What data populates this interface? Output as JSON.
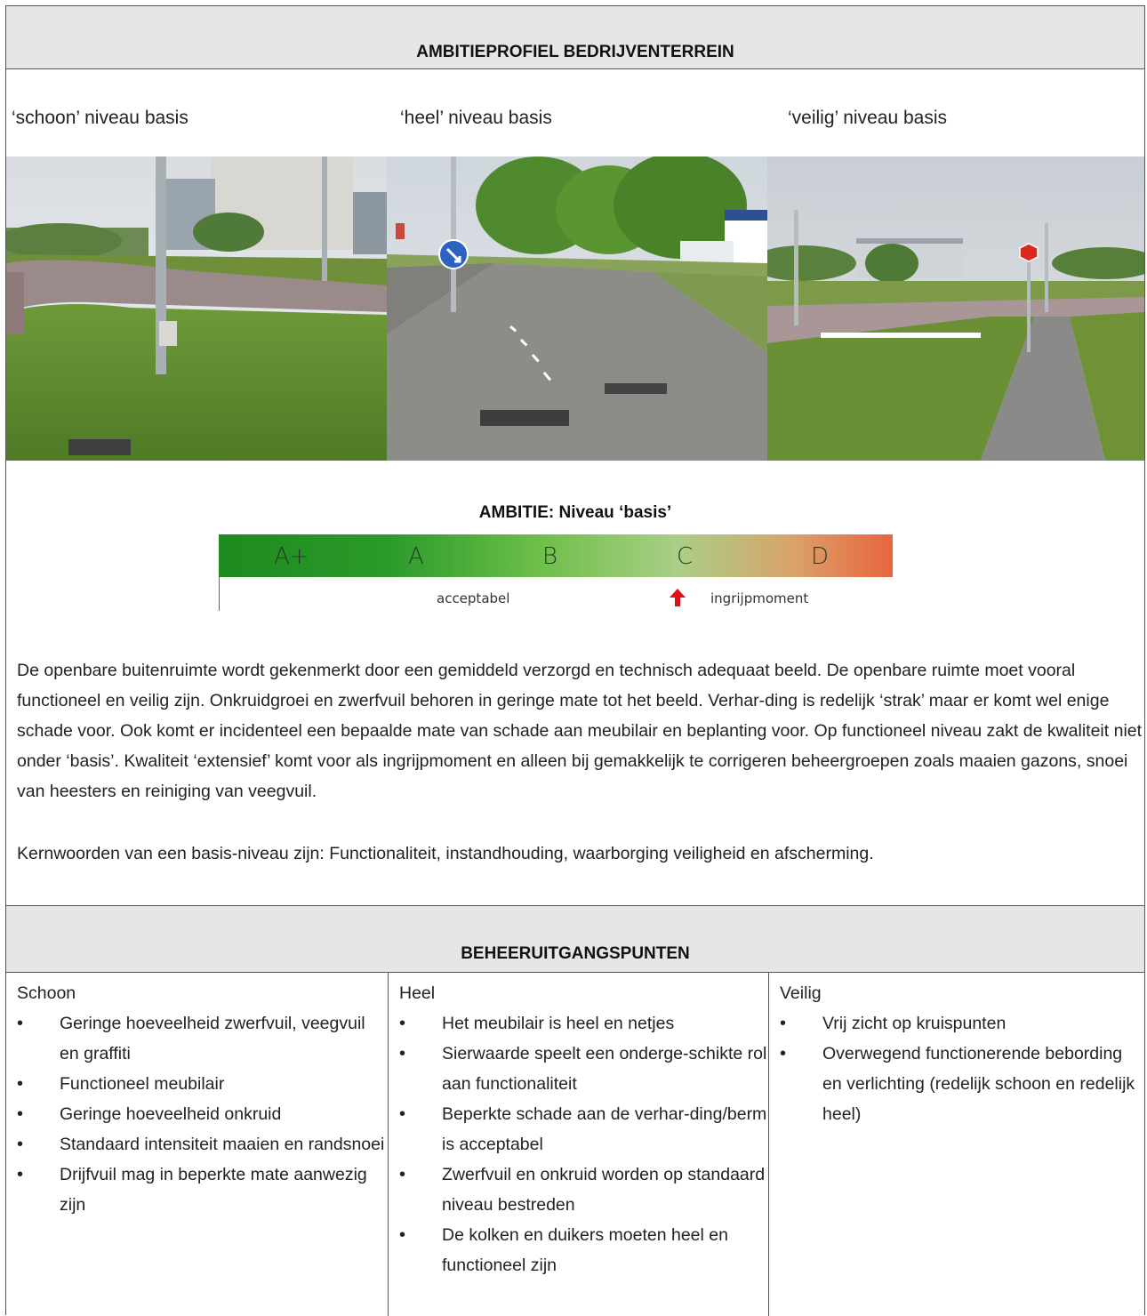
{
  "header": {
    "title": "AMBITIEPROFIEL BEDRIJVENTERREIN"
  },
  "captions": [
    "‘schoon’ niveau basis",
    "‘heel’ niveau basis",
    "‘veilig’ niveau basis"
  ],
  "ambition": {
    "title": "AMBITIE: Niveau ‘basis’",
    "levels": [
      "A+",
      "A",
      "B",
      "C",
      "D"
    ],
    "labels": {
      "acceptable": "acceptabel",
      "intervention": "ingrijpmoment"
    },
    "colors": {
      "start": "#1f8a1f",
      "end": "#e8653f",
      "arrow": "#e01010"
    }
  },
  "description": {
    "p1": "De openbare buitenruimte wordt gekenmerkt door een gemiddeld verzorgd en technisch adequaat beeld. De openbare ruimte moet vooral functioneel en veilig zijn. Onkruidgroei en zwerfvuil behoren in geringe mate tot het beeld. Verhar-ding is redelijk ‘strak’ maar er komt wel enige schade voor. Ook komt er incidenteel een bepaalde mate van schade aan meubilair en beplanting voor. Op functioneel niveau zakt de kwaliteit niet onder ‘basis’. Kwaliteit ‘extensief’ komt voor als ingrijpmoment en alleen bij gemakkelijk te corrigeren beheergroepen zoals maaien gazons, snoei van heesters en reiniging van veegvuil.",
    "p2": "Kernwoorden van een basis-niveau zijn: Functionaliteit, instandhouding, waarborging veiligheid en afscherming."
  },
  "management": {
    "title": "BEHEERUITGANGSPUNTEN",
    "columns": [
      {
        "heading": "Schoon",
        "items": [
          "Geringe hoeveelheid zwerfvuil, veegvuil en graffiti",
          "Functioneel meubilair",
          "Geringe hoeveelheid onkruid",
          "Standaard intensiteit maaien en randsnoei",
          "Drijfvuil mag in beperkte mate aanwezig zijn"
        ]
      },
      {
        "heading": "Heel",
        "items": [
          "Het meubilair is heel en netjes",
          "Sierwaarde speelt een onderge-schikte rol aan functionaliteit",
          "Beperkte schade aan de verhar-ding/berm is acceptabel",
          "Zwerfvuil en onkruid worden op standaard niveau bestreden",
          "De kolken en duikers moeten heel en functioneel zijn"
        ]
      },
      {
        "heading": "Veilig",
        "items": [
          "Vrij zicht op kruispunten",
          "Overwegend functionerende bebording en verlichting (redelijk schoon en redelijk heel)"
        ]
      }
    ]
  }
}
